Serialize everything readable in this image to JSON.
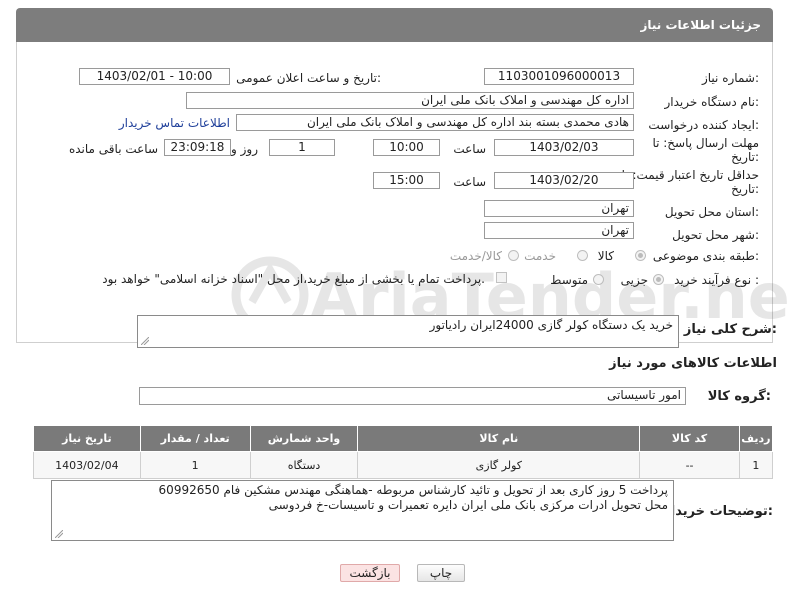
{
  "header": {
    "title": "جزئیات اطلاعات نیاز"
  },
  "fields": {
    "need_number_label": "شماره نیاز:",
    "need_number": "1103001096000013",
    "announce_label": "تاریخ و ساعت اعلان عمومی:",
    "announce_value": "1403/02/01 - 10:00",
    "buyer_org_label": "نام دستگاه خریدار:",
    "buyer_org": "اداره کل مهندسی و املاک بانک ملی ایران",
    "creator_label": "ایجاد کننده درخواست:",
    "creator": "هادی محمدی بسته بند اداره کل مهندسی و املاک بانک ملی ایران",
    "contact_link": "اطلاعات تماس خریدار",
    "deadline_label_1": "مهلت ارسال پاسخ: تا",
    "deadline_label_2": "تاریخ:",
    "deadline_date": "1403/02/03",
    "time_label": "ساعت",
    "deadline_time": "10:00",
    "days_value": "1",
    "days_label": "روز و",
    "remaining_time": "23:09:18",
    "remaining_label": "ساعت باقی مانده",
    "validity_label_1": "حداقل تاریخ اعتبار قیمت: تا",
    "validity_label_2": "تاریخ:",
    "validity_date": "1403/02/20",
    "validity_time": "15:00",
    "province_label": "استان محل تحویل:",
    "province": "تهران",
    "city_label": "شهر محل تحویل:",
    "city": "تهران",
    "category_label": "طبقه بندی موضوعی:",
    "category_options": [
      "کالا",
      "خدمت",
      "کالا/خدمت"
    ],
    "process_label": "نوع فرآیند خرید :",
    "process_options": [
      "جزیی",
      "متوسط"
    ],
    "payment_note": "پرداخت تمام یا بخشی از مبلغ خرید،از محل \"اسناد خزانه اسلامی\" خواهد بود.",
    "description_label": "شرح کلی نیاز:",
    "description": "خرید یک دستگاه کولر گازی 24000ایران رادیاتور",
    "goods_info_title": "اطلاعات کالاهای مورد نیاز",
    "goods_group_label": "گروه کالا:",
    "goods_group": "امور تاسیساتی"
  },
  "table": {
    "headers": [
      "ردیف",
      "کد کالا",
      "نام کالا",
      "واحد شمارش",
      "تعداد / مقدار",
      "تاریخ نیاز"
    ],
    "rows": [
      [
        "1",
        "--",
        "کولر گازی",
        "دستگاه",
        "1",
        "1403/02/04"
      ]
    ]
  },
  "buyer_notes": {
    "label": "توضیحات خریدار:",
    "line1": "پرداخت 5 روز کاری بعد از تحویل و تائید کارشناس مربوطه -هماهنگی مهندس مشکین فام 60992650",
    "line2": "محل تحویل ادرات مرکزی بانک ملی ایران دایره تعمیرات و تاسیسات-خ فردوسی"
  },
  "buttons": {
    "print": "چاپ",
    "back": "بازگشت"
  },
  "watermark": "AriaTender.neT",
  "colors": {
    "header_bg": "#7d7d7d",
    "link": "#1f3f9a",
    "back_button": "#fbe3e3"
  }
}
